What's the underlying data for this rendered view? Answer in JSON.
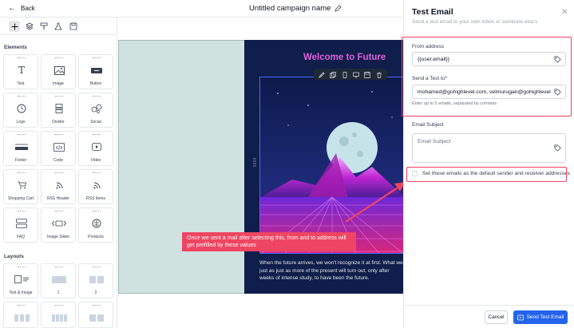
{
  "topbar": {
    "back_label": "Back",
    "campaign_name": "Untitled campaign name"
  },
  "sidebar": {
    "elements_heading": "Elements",
    "elements": [
      {
        "label": "Text",
        "icon": "text-icon"
      },
      {
        "label": "Image",
        "icon": "image-icon"
      },
      {
        "label": "Button",
        "icon": "button-icon"
      },
      {
        "label": "Logo",
        "icon": "logo-icon"
      },
      {
        "label": "Divider",
        "icon": "divider-icon"
      },
      {
        "label": "Social",
        "icon": "social-icon"
      },
      {
        "label": "Footer",
        "icon": "footer-icon"
      },
      {
        "label": "Code",
        "icon": "code-icon"
      },
      {
        "label": "Video",
        "icon": "video-icon"
      },
      {
        "label": "Shopping Cart",
        "icon": "cart-icon"
      },
      {
        "label": "RSS Header",
        "icon": "rss-icon"
      },
      {
        "label": "RSS Items",
        "icon": "rss-icon"
      },
      {
        "label": "FAQ",
        "icon": "faq-icon"
      },
      {
        "label": "Image Slider",
        "icon": "slider-icon"
      },
      {
        "label": "Products",
        "icon": "products-icon"
      }
    ],
    "layouts_heading": "Layouts",
    "layouts": [
      {
        "label": "Text & Image"
      },
      {
        "label": "1"
      },
      {
        "label": "2"
      }
    ]
  },
  "canvas": {
    "email_title": "Welcome to Future",
    "email_body": "When the future arrives, we won't recognize it at first. What we just as just as more of the present will turn out, only after weeks of intense study, to have been the future."
  },
  "annotation": {
    "text": "Once we sent a mail after selecting this, from and to address will get prefilled by these values",
    "color": "#ee4562"
  },
  "drawer": {
    "title": "Test Email",
    "subtitle": "Send a test email to your own inbox or someone else's",
    "from_label": "From address",
    "from_value": "{{user.email}}",
    "to_label": "Send a Test to*",
    "to_value": "mohamed@gohighlevel.com, velmurugan@gohighlevel",
    "to_hint": "Enter up to 5 emails, separated by commas",
    "subject_label": "Email Subject",
    "subject_placeholder": "Email Subject",
    "default_checkbox_label": "Set these emails as the default sender and receiver addresses",
    "cancel_label": "Cancel",
    "send_label": "Send Test Email",
    "accent_color": "#2563eb"
  }
}
